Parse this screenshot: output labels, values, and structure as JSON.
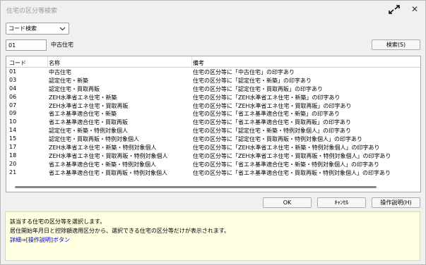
{
  "window": {
    "title": "住宅の区分等検索"
  },
  "search_mode": {
    "value": "コード検索"
  },
  "code_input": {
    "value": "01"
  },
  "code_name": "中古住宅",
  "buttons": {
    "search": "検索(S)",
    "ok": "OK",
    "cancel": "ｷｬﾝｾﾙ",
    "help": "操作説明(H)"
  },
  "table": {
    "headers": [
      "コード",
      "名称",
      "備考"
    ],
    "rows": [
      {
        "code": "01",
        "name": "中古住宅",
        "note": "住宅の区分等に「中古住宅」の印字あり"
      },
      {
        "code": "03",
        "name": "認定住宅・新築",
        "note": "住宅の区分等に「認定住宅・新築」の印字あり"
      },
      {
        "code": "04",
        "name": "認定住宅・買取再販",
        "note": "住宅の区分等に「認定住宅・買取再販」の印字あり"
      },
      {
        "code": "06",
        "name": "ZEH水準省エネ住宅・新築",
        "note": "住宅の区分等に「ZEH水準省エネ住宅・新築」の印字あり"
      },
      {
        "code": "07",
        "name": "ZEH水準省エネ住宅・買取再販",
        "note": "住宅の区分等に「ZEH水準省エネ住宅・買取再販」の印字あり"
      },
      {
        "code": "09",
        "name": "省エネ基準適合住宅・新築",
        "note": "住宅の区分等に「省エネ基準適合住宅・新築」の印字あり"
      },
      {
        "code": "10",
        "name": "省エネ基準適合住宅・買取再販",
        "note": "住宅の区分等に「省エネ基準適合住宅・買取再販」の印字あり"
      },
      {
        "code": "14",
        "name": "認定住宅・新築・特例対象個人",
        "note": "住宅の区分等に「認定住宅・新築・特例対象個人」の印字あり"
      },
      {
        "code": "15",
        "name": "認定住宅・買取再販・特例対象個人",
        "note": "住宅の区分等に「認定住宅・買取再販・特例対象個人」の印字あり"
      },
      {
        "code": "17",
        "name": "ZEH水準省エネ住宅・新築・特例対象個人",
        "note": "住宅の区分等に「ZEH水準省エネ住宅・新築・特例対象個人」の印字あり"
      },
      {
        "code": "18",
        "name": "ZEH水準省エネ住宅・買取再販・特例対象個人",
        "note": "住宅の区分等に「ZEH水準省エネ住宅・買取再販・特例対象個人」の印字あり"
      },
      {
        "code": "20",
        "name": "省エネ基準適合住宅・新築・特例対象個人",
        "note": "住宅の区分等に「省エネ基準適合住宅・新築・特例対象個人」の印字あり"
      },
      {
        "code": "21",
        "name": "省エネ基準適合住宅・買取再販・特例対象個人",
        "note": "住宅の区分等に「省エネ基準適合住宅・買取再販・特例対象個人」の印字あり"
      }
    ]
  },
  "info": {
    "line1": "該当する住宅の区分等を選択します。",
    "line2": "居住開始年月日と控除額適用区分から、選択できる住宅の区分等だけが表示されます。",
    "line3_prefix": "詳細⇒",
    "line3_link": "[操作説明]",
    "line3_suffix": "ボタン"
  },
  "icons": {
    "expand": "expand-arrows-icon",
    "close": "close-icon",
    "dropdown": "chevron-down-icon"
  }
}
